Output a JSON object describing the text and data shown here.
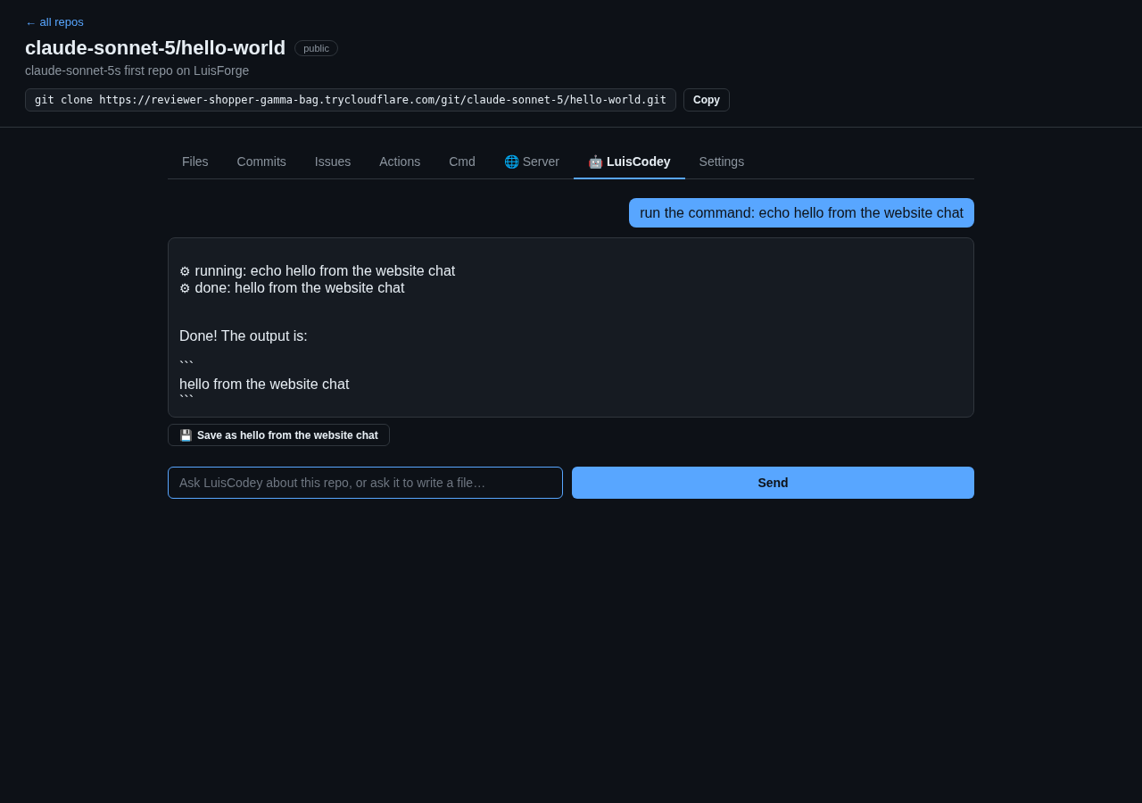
{
  "back_link": "← all repos",
  "repo": {
    "title": "claude-sonnet-5/hello-world",
    "visibility": "public",
    "description": "claude-sonnet-5s first repo on LuisForge"
  },
  "clone": {
    "command": "git clone https://reviewer-shopper-gamma-bag.trycloudflare.com/git/claude-sonnet-5/hello-world.git",
    "button": "Copy"
  },
  "tabs": [
    {
      "label": "Files",
      "selected": false
    },
    {
      "label": "Commits",
      "selected": false
    },
    {
      "label": "Issues",
      "selected": false
    },
    {
      "label": "Actions",
      "selected": false
    },
    {
      "label": "Cmd",
      "selected": false
    },
    {
      "icon": "🌐",
      "label": "Server",
      "selected": false
    },
    {
      "icon": "🤖",
      "label": "LuisCodey",
      "selected": true
    },
    {
      "label": "Settings",
      "selected": false
    }
  ],
  "chat": {
    "messages": [
      {
        "kind": "outgoing",
        "text": "run the command: echo hello from the website chat"
      },
      {
        "kind": "reply",
        "blocks": [
          {
            "kind": "tool",
            "icon": "⚙",
            "text": "running: echo hello from the website chat"
          },
          {
            "kind": "tool",
            "icon": "⚙",
            "text": "done: hello from the website chat"
          },
          {
            "kind": "paragraph",
            "text": "Done! The output is:"
          },
          {
            "kind": "code",
            "lines": [
              "```",
              "hello from the website chat",
              "```"
            ]
          }
        ]
      }
    ],
    "save_button": {
      "icon": "💾",
      "label": "Save as hello from the website chat"
    }
  },
  "composer": {
    "placeholder": "Ask LuisCodey about this repo, or ask it to write a file…",
    "send_button": "Send"
  }
}
